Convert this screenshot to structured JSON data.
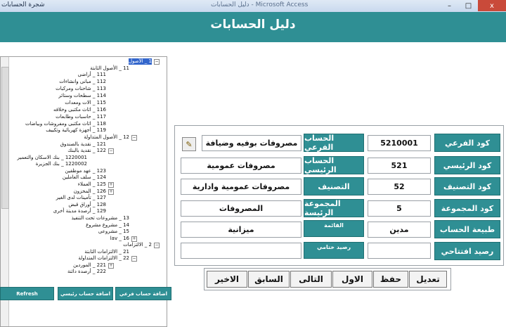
{
  "window": {
    "left_title": "شجرة الحسابات",
    "center_title": "دليل الحسابات - Microsoft Access",
    "min": "–",
    "max": "□",
    "close": "x"
  },
  "header": {
    "title": "دليل الحسابات"
  },
  "tree": {
    "nodes": [
      {
        "text": "1 _ الأصول",
        "selected": true
      },
      {
        "text": "11 _ الأصول الثابتة"
      },
      {
        "text": "111 _ أراضى"
      },
      {
        "text": "112 _ مبانى وانشاءات"
      },
      {
        "text": "113 _ شاحنات ومركبات"
      },
      {
        "text": "114 _ سطحات وستائر"
      },
      {
        "text": "115 _ الات ومعدات"
      },
      {
        "text": "116 _ اثاث مكتبى وخلافه"
      },
      {
        "text": "117 _ حاسبات وطابعات"
      },
      {
        "text": "118 _ اثاث مكتبى ومفروشات وبياضات"
      },
      {
        "text": "119 _ أجهزة كهربائية وتكييف"
      },
      {
        "text": "12 _ الأصول المتداولة"
      },
      {
        "text": "121 _ نقدية بالصندوق"
      },
      {
        "text": "122 _ نقدية بالبنك"
      },
      {
        "text": "1220001 _ بنك الاسكان والتعمير"
      },
      {
        "text": "1220002 _ بنك الجزيرة"
      },
      {
        "text": "123 _ عهد موظفين"
      },
      {
        "text": "124 _ سلف العاملين"
      },
      {
        "text": "125 _ العملاء"
      },
      {
        "text": "126 _ المخزون"
      },
      {
        "text": "127 _ تأمينات لدى الغير"
      },
      {
        "text": "128 _ أوراق قبض"
      },
      {
        "text": "129 _ أرصدة مدينة أخرى"
      },
      {
        "text": "13 _ مشروعات تحت التنفيذ"
      },
      {
        "text": "14 _ مشروع مشروع"
      },
      {
        "text": "15 _ مشروعى"
      },
      {
        "text": "16 _ lav"
      },
      {
        "text": "2 _ الالتزامات"
      },
      {
        "text": "21 _ الالتزامات الثابتة"
      },
      {
        "text": "22 _ الالتزامات المتداولة"
      },
      {
        "text": "221 _ الموردين"
      },
      {
        "text": "222 _ أرصدة دائنة"
      }
    ]
  },
  "left_buttons": {
    "refresh": "Refresh",
    "add_main": "اضافة حساب رئيسي",
    "add_sub": "اضافة حساب فرعي"
  },
  "form": {
    "sub_code_label": "كود الفرعي",
    "sub_code_value": "5210001",
    "sub_account_label": "الحساب الفرعي",
    "sub_account_value": "مصروفات بوفيه وضيافة",
    "main_code_label": "كود الرئيسي",
    "main_code_value": "521",
    "main_account_label": "الحساب الرئيسي",
    "main_account_value": "مصروفات عمومية",
    "class_code_label": "كود التصنيف",
    "class_code_value": "52",
    "class_label": "التصنيف",
    "class_value": "مصروفات عمومية وادارية",
    "group_code_label": "كود المجموعة",
    "group_code_value": "5",
    "group_label": "المجموعة الرئيسة",
    "group_value": "المصروفات",
    "nature_label": "طبيعة الحساب",
    "nature_value": "مدين",
    "list_label": "القائمة",
    "list_value": "ميزانية",
    "opening_balance_label": "رصيد افتتاحي",
    "opening_balance_value": "",
    "closing_balance_label": "رصيد ختامي",
    "closing_balance_value": ""
  },
  "buttons": {
    "edit": "تعديل",
    "save": "حفظ",
    "first": "الاول",
    "next": "التالى",
    "prev": "السابق",
    "last": "الاخير"
  },
  "colors": {
    "accent": "#2f8f94",
    "selection": "#3366cc"
  }
}
